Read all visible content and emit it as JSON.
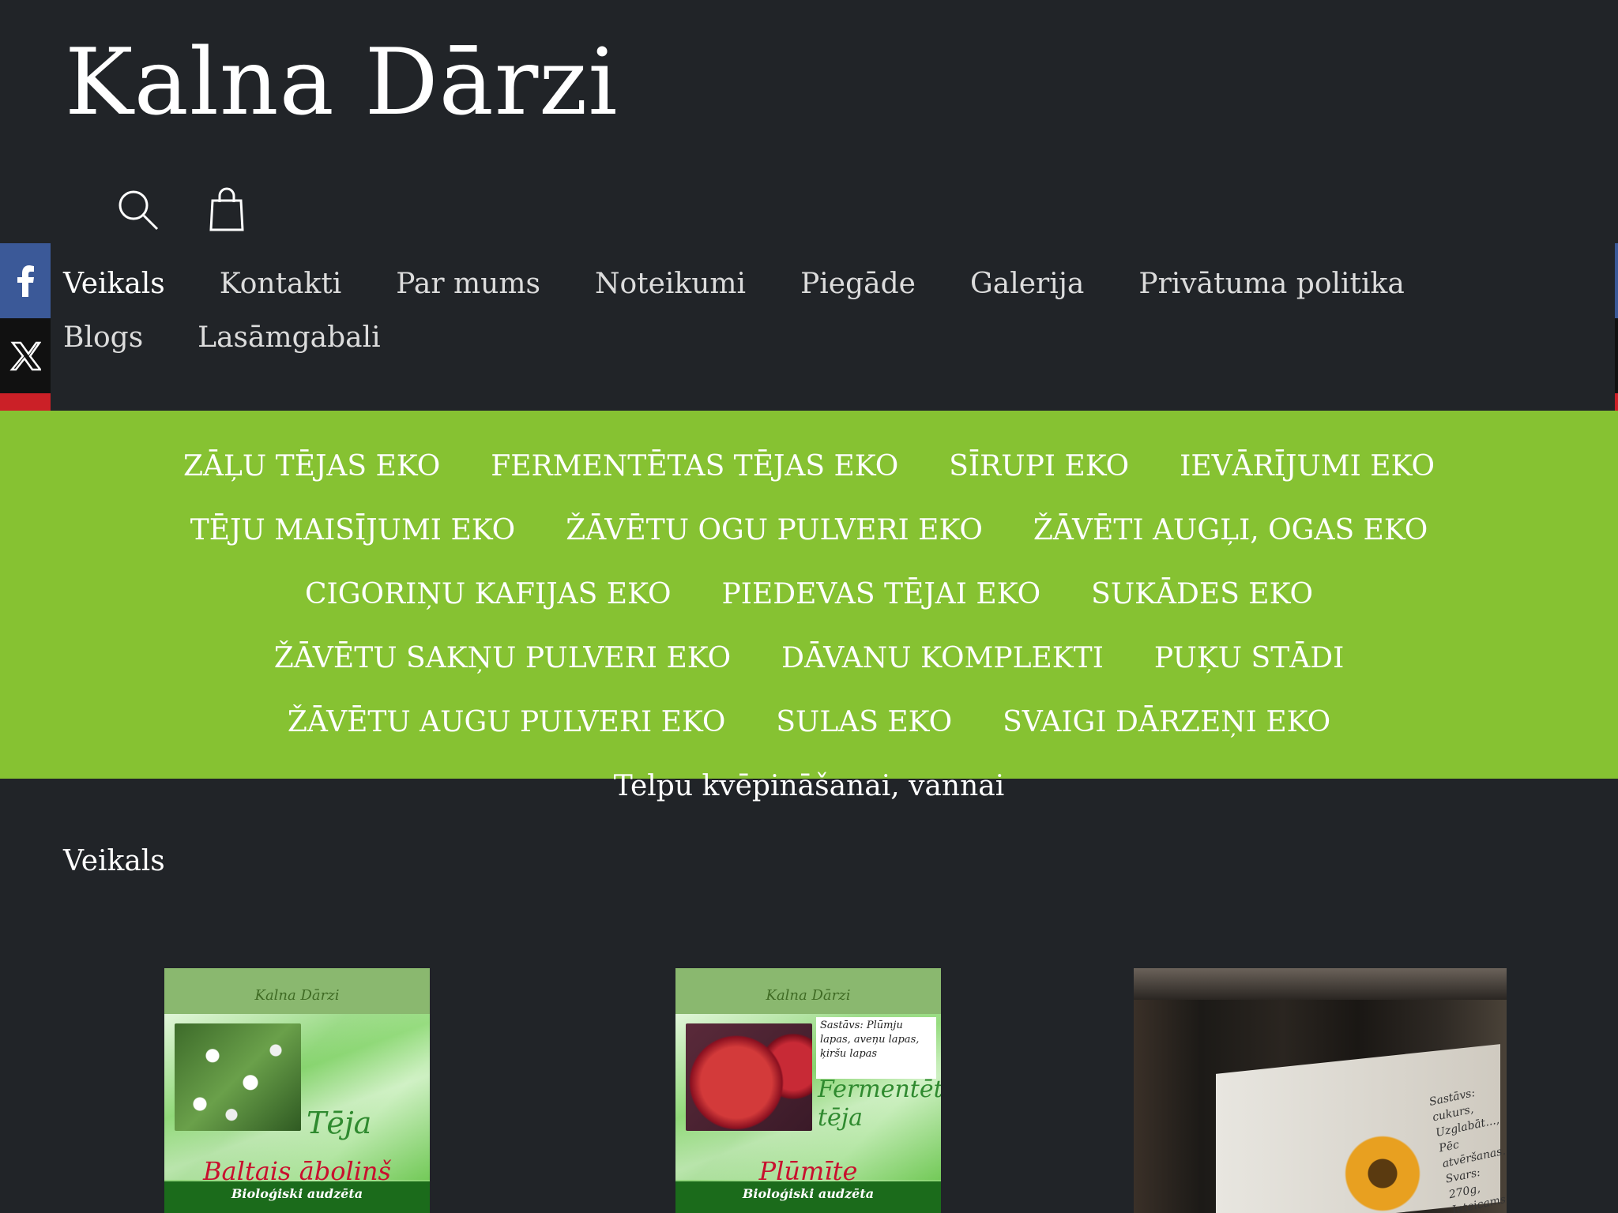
{
  "site": {
    "title": "Kalna Dārzi"
  },
  "header_icons": [
    "search-icon",
    "bag-icon"
  ],
  "main_nav": {
    "items": [
      "Veikals",
      "Kontakti",
      "Par mums",
      "Noteikumi",
      "Piegāde",
      "Galerija",
      "Privātuma politika",
      "Blogs",
      "Lasāmgabali"
    ]
  },
  "social": [
    "facebook-icon",
    "x-icon",
    "pinterest-icon"
  ],
  "category_nav": {
    "items": [
      "ZĀĻU TĒJAS EKO",
      "FERMENTĒTAS TĒJAS EKO",
      "SĪRUPI EKO",
      "IEVĀRĪJUMI EKO",
      "TĒJU MAISĪJUMI EKO",
      "ŽĀVĒTU OGU PULVERI EKO",
      "ŽĀVĒTI AUGĻI, OGAS EKO",
      "CIGORIŅU KAFIJAS EKO",
      "PIEDEVAS TĒJAI EKO",
      "SUKĀDES EKO",
      "ŽĀVĒTU SAKŅU PULVERI EKO",
      "DĀVANU KOMPLEKTI",
      "PUĶU STĀDI",
      "ŽĀVĒTU AUGU PULVERI EKO",
      "SULAS EKO",
      "SVAIGI DĀRZEŅI EKO",
      "Telpu kvēpināšanai, vannai"
    ]
  },
  "breadcrumb": "Veikals",
  "products": [
    {
      "brand": "Kalna Dārzi",
      "type": "Tēja",
      "name": "Baltais āboliņš",
      "band": "Bioloģiski audzēta"
    },
    {
      "brand": "Kalna Dārzi",
      "info": "Sastāvs: Plūmju lapas, aveņu lapas, ķiršu lapas",
      "type": "Fermentētā tēja",
      "name": "Plūmīte",
      "band": "Bioloģiski audzēta"
    },
    {
      "label_text": "Sastāvs: cukurs, Uzglabāt..., Pēc atvēršanas..., Svars: 270g, Ieteicams..., Partijas..."
    }
  ],
  "colors": {
    "background": "#212428",
    "accent": "#86c232",
    "facebook": "#3b5998",
    "x": "#111111",
    "pinterest": "#cb2027",
    "sale_red": "#c8102e"
  }
}
